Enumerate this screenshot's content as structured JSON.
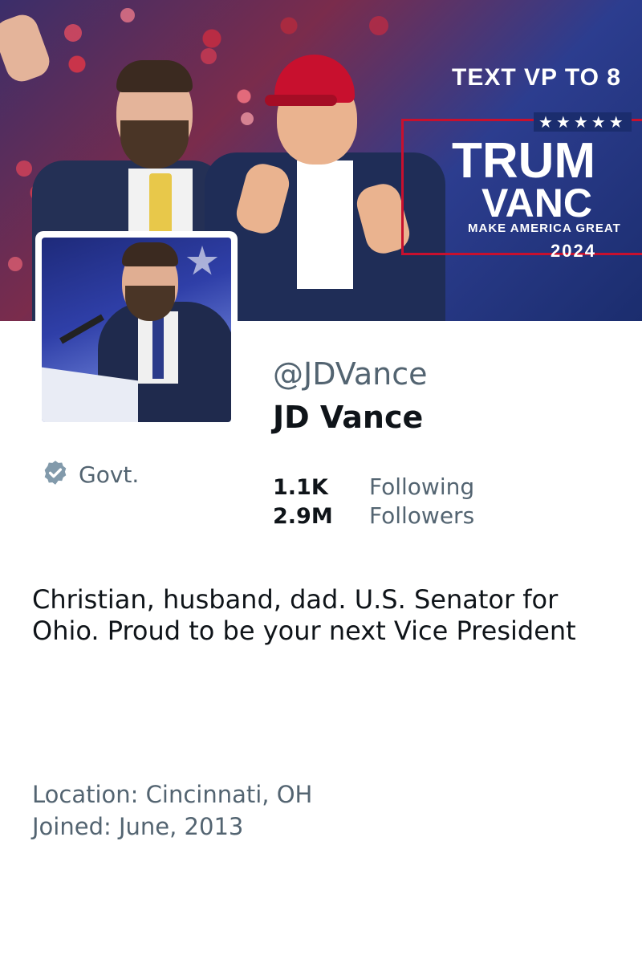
{
  "banner": {
    "promo_line": "TEXT VP TO 8",
    "promo_stars": "★★★★★",
    "promo_name1": "TRUM",
    "promo_name2": "VANC",
    "promo_slogan": "MAKE AMERICA GREAT",
    "promo_year": "2024",
    "cap_text": "MAKE AMERICA GREAT",
    "colors": {
      "red": "#c8102e",
      "navy": "#1b2d6e"
    }
  },
  "profile": {
    "handle": "@JDVance",
    "display_name": "JD Vance",
    "badge_label": "Govt.",
    "badge_icon": "verified-icon",
    "stats": [
      {
        "count": "1.1K",
        "label": "Following"
      },
      {
        "count": "2.9M",
        "label": "Followers"
      }
    ],
    "bio": "Christian, husband, dad. U.S. Senator for Ohio. Proud to be your next Vice President",
    "location": "Location: Cincinnati, OH",
    "joined": "Joined: June, 2013"
  },
  "theme": {
    "text": "#0f1419",
    "muted": "#536471",
    "badge": "#829aab"
  }
}
